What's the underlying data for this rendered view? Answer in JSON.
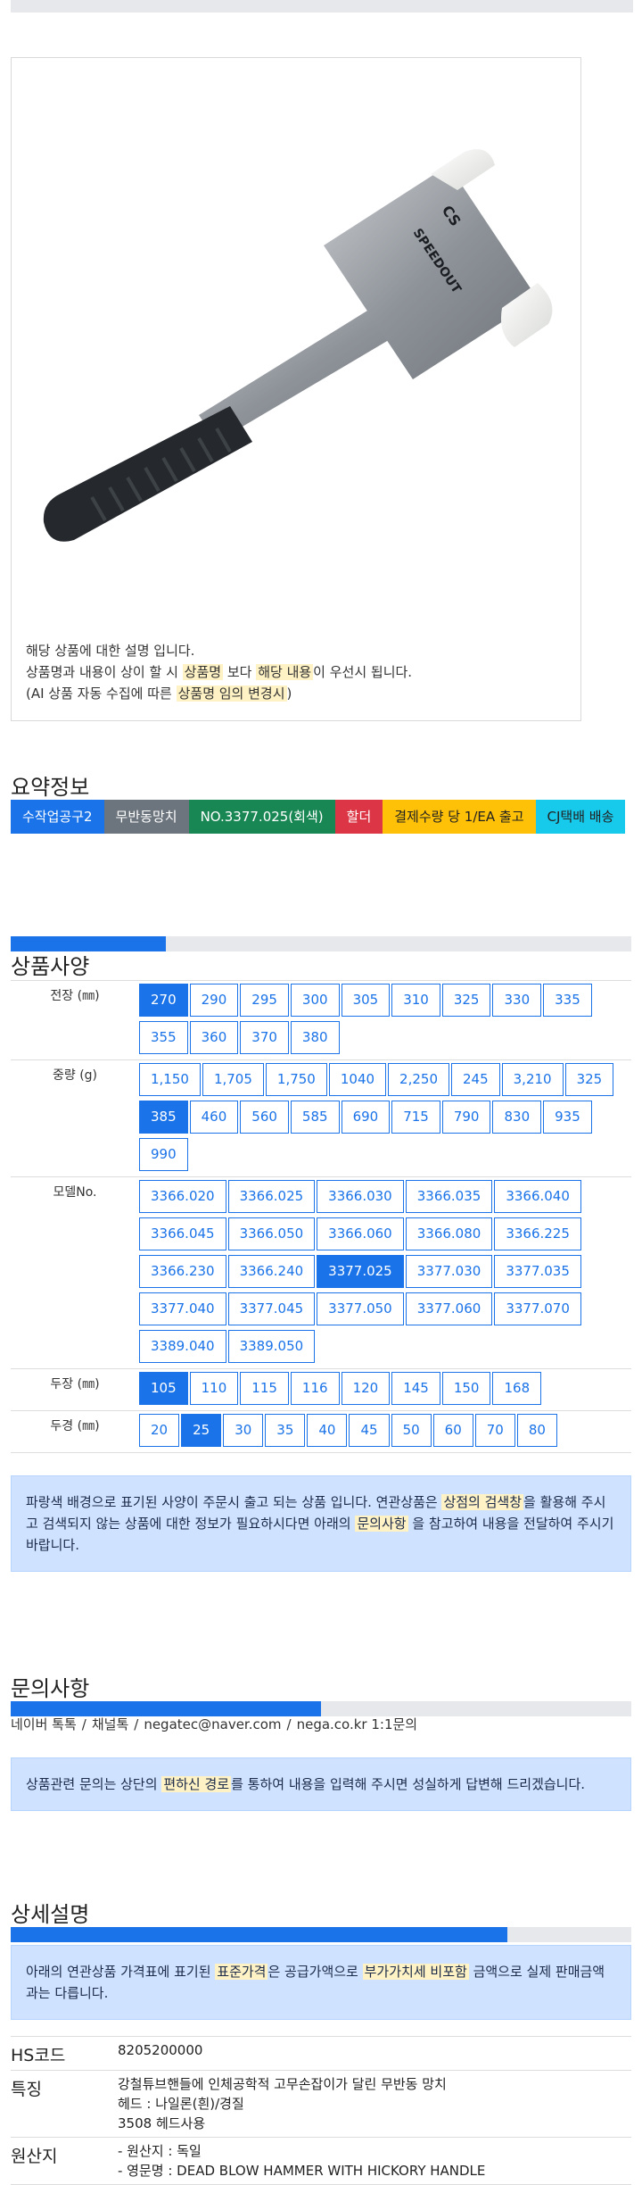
{
  "product": {
    "desc_line1": "해당 상품에 대한 설명 입니다.",
    "desc_line2_a": "상품명과 내용이 상이 할 시 ",
    "desc_line2_hl1": "상품명",
    "desc_line2_b": " 보다 ",
    "desc_line2_hl2": "해당 내용",
    "desc_line2_c": "이 우선시 됩니다.",
    "desc_line3_a": "(AI 상품 자동 수집에 따른 ",
    "desc_line3_hl": "상품명 임의 변경시",
    "desc_line3_b": ")",
    "hammer_brand_text": "SPEEDOUT",
    "hammer_logo_text": "CS"
  },
  "summary": {
    "title": "요약정보",
    "tags": [
      "수작업공구2",
      "무반동망치",
      "NO.3377.025(회색)",
      "할더",
      "결제수량 당 1/EA 출고",
      "CJ택배 배송"
    ]
  },
  "spec": {
    "title": "상품사양",
    "progress": 0.25,
    "rows": [
      {
        "label": "전장 (㎜)",
        "options": [
          "270",
          "290",
          "295",
          "300",
          "305",
          "310",
          "325",
          "330",
          "335",
          "355",
          "360",
          "370",
          "380"
        ],
        "selected": 0
      },
      {
        "label": "중량 (g)",
        "options": [
          "1,150",
          "1,705",
          "1,750",
          "1040",
          "2,250",
          "245",
          "3,210",
          "325",
          "385",
          "460",
          "560",
          "585",
          "690",
          "715",
          "790",
          "830",
          "935",
          "990"
        ],
        "selected": 8
      },
      {
        "label": "모델No.",
        "options": [
          "3366.020",
          "3366.025",
          "3366.030",
          "3366.035",
          "3366.040",
          "3366.045",
          "3366.050",
          "3366.060",
          "3366.080",
          "3366.225",
          "3366.230",
          "3366.240",
          "3377.025",
          "3377.030",
          "3377.035",
          "3377.040",
          "3377.045",
          "3377.050",
          "3377.060",
          "3377.070",
          "3389.040",
          "3389.050"
        ],
        "selected": 12
      },
      {
        "label": "두장 (㎜)",
        "options": [
          "105",
          "110",
          "115",
          "116",
          "120",
          "145",
          "150",
          "168"
        ],
        "selected": 0
      },
      {
        "label": "두경 (㎜)",
        "options": [
          "20",
          "25",
          "30",
          "35",
          "40",
          "45",
          "50",
          "60",
          "70",
          "80"
        ],
        "selected": 1
      }
    ],
    "notice_a": "파랑색 배경으로 표기된 사양이 주문시 출고 되는 상품 입니다. 연관상품은 ",
    "notice_hl1": "상점의 검색창",
    "notice_b": "을 활용해 주시고 검색되지 않는 상품에 대한 정보가 필요하시다면 아래의 ",
    "notice_hl2": "문의사항",
    "notice_c": " 을 참고하여 내용을 전달하여 주시기 바랍니다."
  },
  "inquiry": {
    "title": "문의사항",
    "progress": 0.5,
    "links": [
      "네이버 톡톡",
      "채널톡",
      "negatec@naver.com",
      "nega.co.kr 1:1문의"
    ],
    "separator": "/",
    "notice_a": "상품관련 문의는 상단의 ",
    "notice_hl": "편하신 경로",
    "notice_b": "를 통하여 내용을 입력해 주시면 성실하게 답변해 드리겠습니다."
  },
  "detail": {
    "title": "상세설명",
    "progress": 0.8,
    "notice_a": "아래의 연관상품 가격표에 표기된 ",
    "notice_hl1": "표준가격",
    "notice_b": "은 공급가액으로 ",
    "notice_hl2": "부가가치세 비포함",
    "notice_c": " 금액으로 실제 판매금액과는 다릅니다.",
    "info": [
      {
        "label": "HS코드",
        "lines": [
          "8205200000"
        ]
      },
      {
        "label": "특징",
        "lines": [
          "강철튜브핸들에 인체공학적 고무손잡이가 달린 무반동 망치",
          "헤드 : 나일론(흰)/경질",
          "3508 헤드사용"
        ]
      },
      {
        "label": "원산지",
        "lines": [
          "- 원산지 : 독일",
          "- 영문명 : DEAD BLOW HAMMER WITH HICKORY HANDLE"
        ]
      }
    ]
  },
  "colors": {
    "accent": "#1a73e8",
    "notice_bg": "#cfe2ff",
    "highlight": "#fff2c4"
  }
}
